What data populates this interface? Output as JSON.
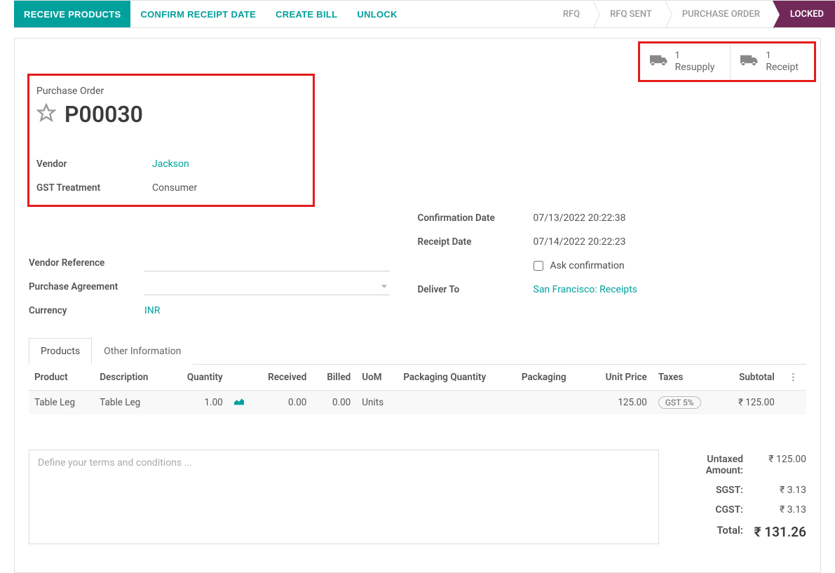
{
  "toolbar": {
    "receive_products": "RECEIVE PRODUCTS",
    "confirm_receipt_date": "CONFIRM RECEIPT DATE",
    "create_bill": "CREATE BILL",
    "unlock": "UNLOCK"
  },
  "statusbar": {
    "rfq": "RFQ",
    "rfq_sent": "RFQ SENT",
    "purchase_order": "PURCHASE ORDER",
    "locked": "LOCKED"
  },
  "stat_buttons": {
    "resupply": {
      "count": "1",
      "label": "Resupply"
    },
    "receipt": {
      "count": "1",
      "label": "Receipt"
    }
  },
  "header": {
    "doc_label": "Purchase Order",
    "doc_number": "P00030"
  },
  "fields": {
    "left": {
      "vendor_label": "Vendor",
      "vendor_value": "Jackson",
      "gst_label": "GST Treatment",
      "gst_value": "Consumer",
      "vendor_ref_label": "Vendor Reference",
      "vendor_ref_value": "",
      "purchase_agreement_label": "Purchase Agreement",
      "purchase_agreement_value": "",
      "currency_label": "Currency",
      "currency_value": "INR"
    },
    "right": {
      "confirmation_date_label": "Confirmation Date",
      "confirmation_date_value": "07/13/2022 20:22:38",
      "receipt_date_label": "Receipt Date",
      "receipt_date_value": "07/14/2022 20:22:23",
      "ask_confirmation_label": "Ask confirmation",
      "deliver_to_label": "Deliver To",
      "deliver_to_value": "San Francisco: Receipts"
    }
  },
  "tabs": {
    "products": "Products",
    "other_info": "Other Information"
  },
  "table": {
    "headers": {
      "product": "Product",
      "description": "Description",
      "quantity": "Quantity",
      "received": "Received",
      "billed": "Billed",
      "uom": "UoM",
      "packaging_qty": "Packaging Quantity",
      "packaging": "Packaging",
      "unit_price": "Unit Price",
      "taxes": "Taxes",
      "subtotal": "Subtotal"
    },
    "rows": [
      {
        "product": "Table Leg",
        "description": "Table Leg",
        "quantity": "1.00",
        "received": "0.00",
        "billed": "0.00",
        "uom": "Units",
        "packaging_qty": "",
        "packaging": "",
        "unit_price": "125.00",
        "taxes": "GST 5%",
        "subtotal": "₹ 125.00"
      }
    ]
  },
  "terms_placeholder": "Define your terms and conditions ...",
  "totals": {
    "untaxed_label": "Untaxed Amount:",
    "untaxed_value": "₹ 125.00",
    "sgst_label": "SGST:",
    "sgst_value": "₹ 3.13",
    "cgst_label": "CGST:",
    "cgst_value": "₹ 3.13",
    "total_label": "Total:",
    "total_value": "₹ 131.26"
  }
}
